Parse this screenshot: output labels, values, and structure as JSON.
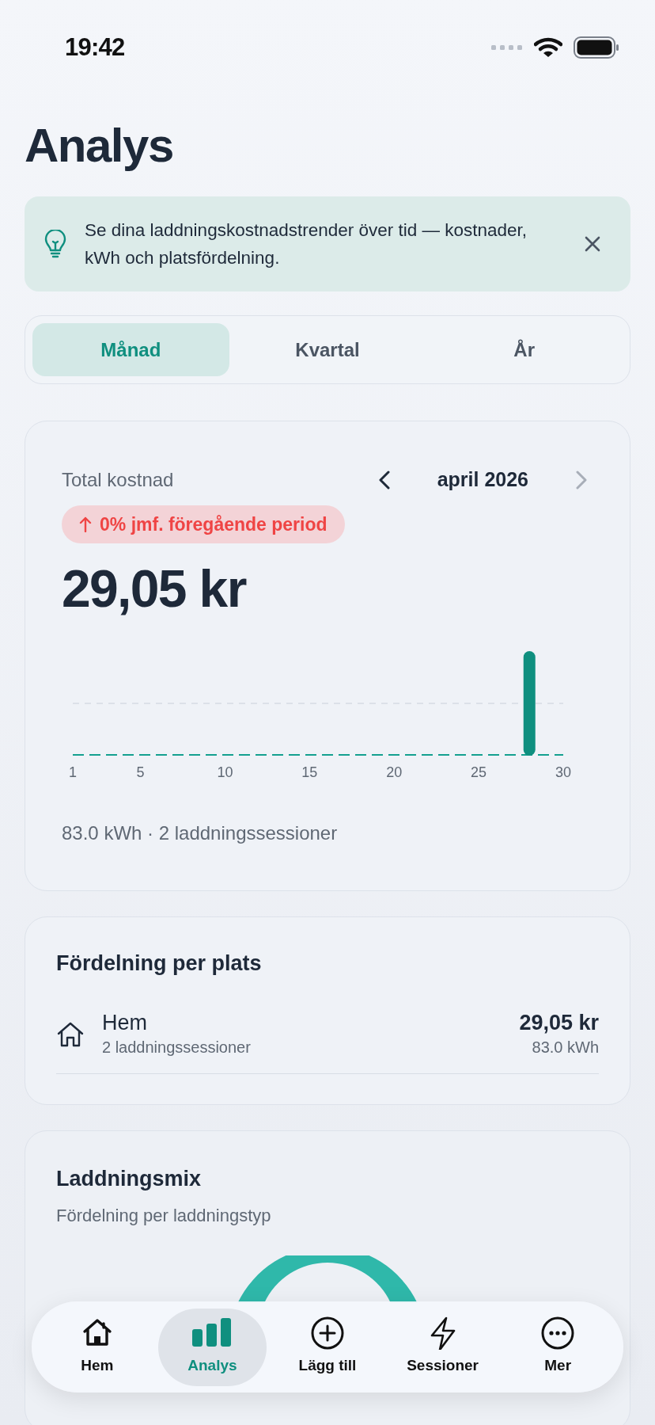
{
  "status_bar": {
    "time": "19:42"
  },
  "title": "Analys",
  "banner": {
    "text": "Se dina laddningskostnadstrender över tid — kostnader, kWh och platsfördelning."
  },
  "period_tabs": [
    {
      "label": "Månad",
      "selected": true
    },
    {
      "label": "Kvartal",
      "selected": false
    },
    {
      "label": "År",
      "selected": false
    }
  ],
  "cost_card": {
    "label": "Total kostnad",
    "period": "april 2026",
    "next_disabled": true,
    "change_badge": "0% jmf. föregående period",
    "total": "29,05 kr",
    "chart": {
      "x_labels": [
        "1",
        "5",
        "10",
        "15",
        "20",
        "25",
        "30"
      ]
    },
    "summary": "83.0 kWh · 2 laddningssessioner"
  },
  "locations_card": {
    "title": "Fördelning per plats",
    "rows": [
      {
        "name": "Hem",
        "sessions": "2 laddningssessioner",
        "cost": "29,05 kr",
        "energy": "83.0 kWh"
      }
    ]
  },
  "mix_card": {
    "title": "Laddningsmix",
    "subtitle": "Fördelning per laddningstyp"
  },
  "tab_bar": [
    {
      "label": "Hem",
      "kind": "home",
      "selected": false
    },
    {
      "label": "Analys",
      "kind": "bars",
      "selected": true
    },
    {
      "label": "Lägg till",
      "kind": "plus",
      "selected": false
    },
    {
      "label": "Sessioner",
      "kind": "bolt",
      "selected": false
    },
    {
      "label": "Mer",
      "kind": "more",
      "selected": false
    }
  ]
}
